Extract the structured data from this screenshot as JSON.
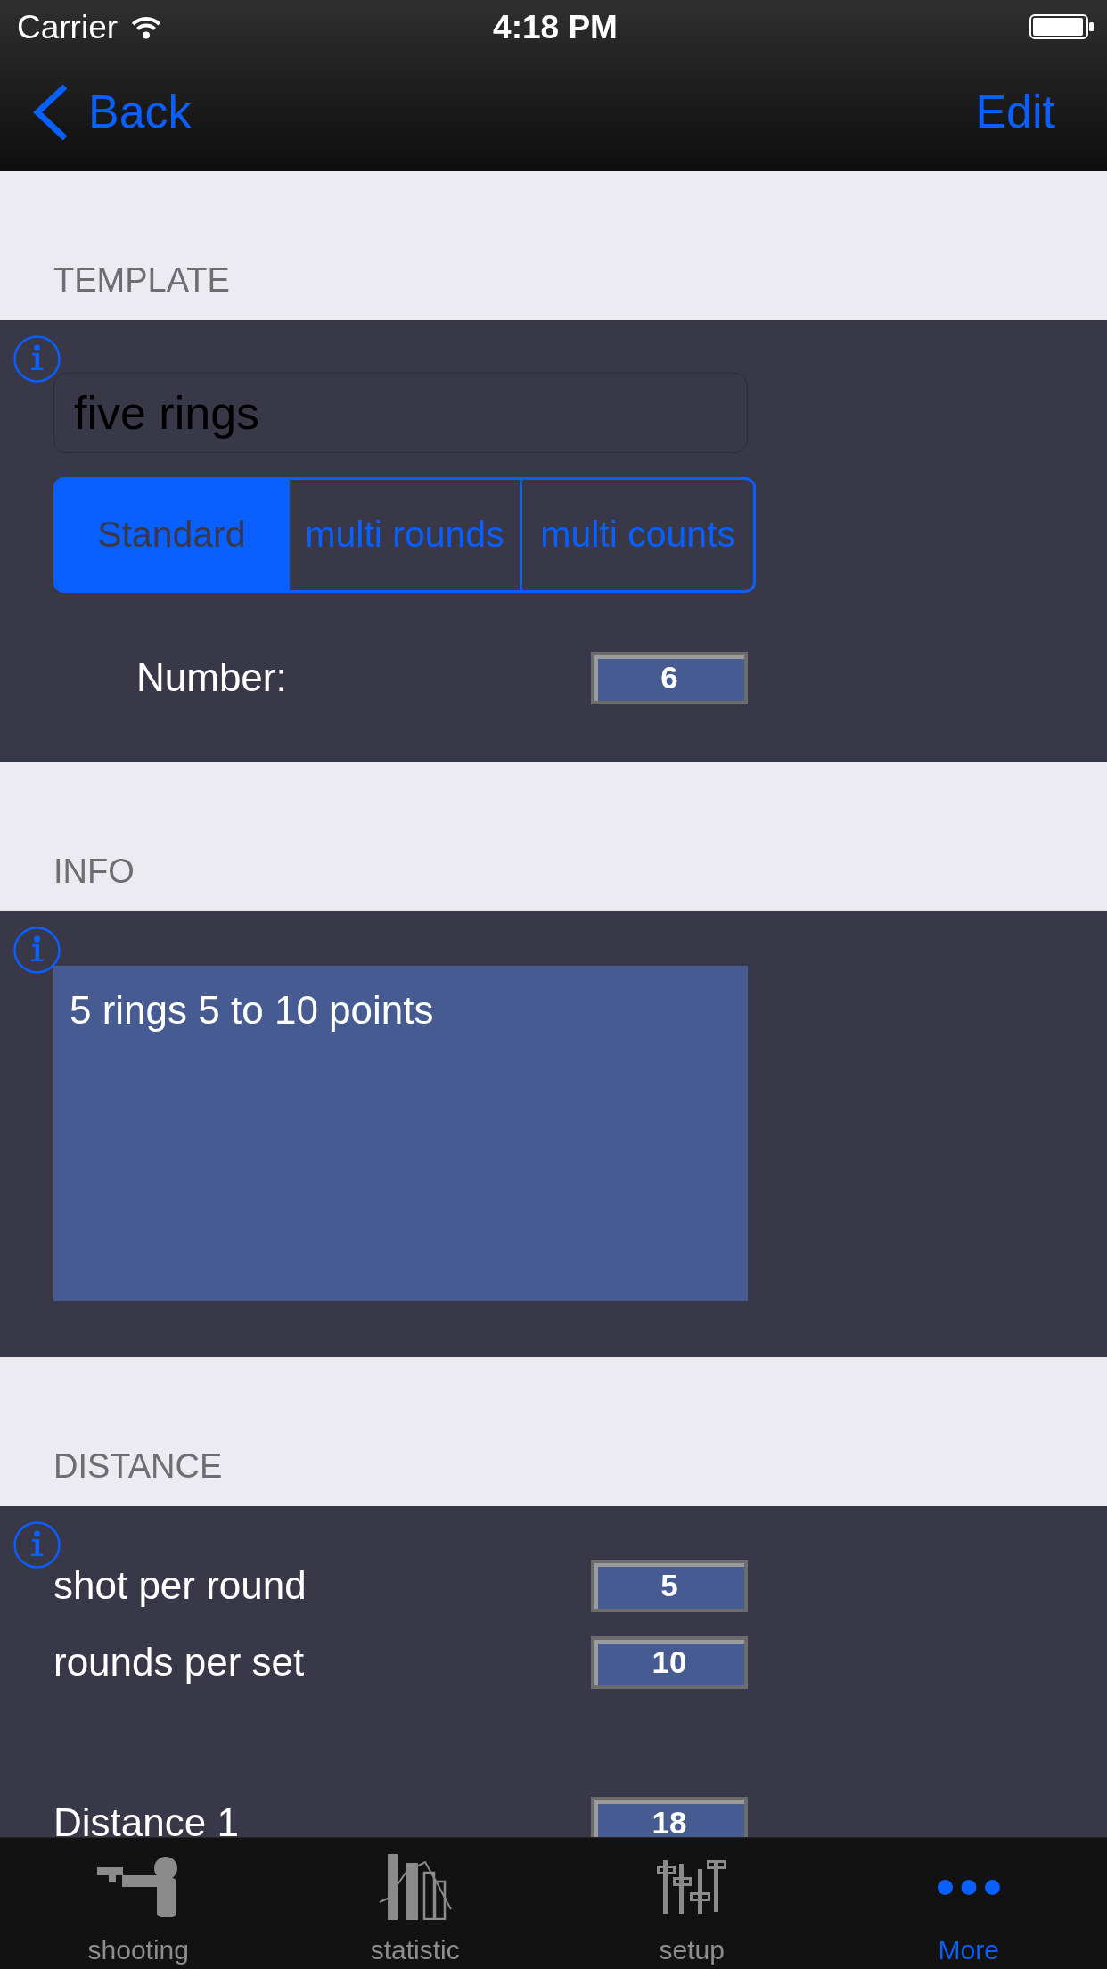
{
  "status_bar": {
    "carrier": "Carrier",
    "time": "4:18 PM"
  },
  "nav_bar": {
    "back": "Back",
    "action": "Edit"
  },
  "sections": [
    {
      "kind": "template",
      "header": "TEMPLATE",
      "name_field": {
        "value": "five rings"
      },
      "segments": [
        {
          "label": "Standard",
          "selected": true
        },
        {
          "label": "multi rounds",
          "selected": false
        },
        {
          "label": "multi counts",
          "selected": false
        }
      ],
      "number": {
        "label": "Number:",
        "value": "6"
      }
    },
    {
      "kind": "info",
      "header": "INFO",
      "text": "5 rings 5 to 10 points"
    },
    {
      "kind": "distance",
      "header": "DISTANCE",
      "counts": [
        {
          "label": "shot per round",
          "value": "5"
        },
        {
          "label": "rounds per set",
          "value": "10"
        }
      ],
      "distances": [
        {
          "label": "Distance 1",
          "value": "18"
        }
      ]
    }
  ],
  "tab_bar": [
    {
      "label": "shooting",
      "selected": false
    },
    {
      "label": "statistic",
      "selected": false
    },
    {
      "label": "setup",
      "selected": false
    },
    {
      "label": "More",
      "selected": true
    }
  ]
}
